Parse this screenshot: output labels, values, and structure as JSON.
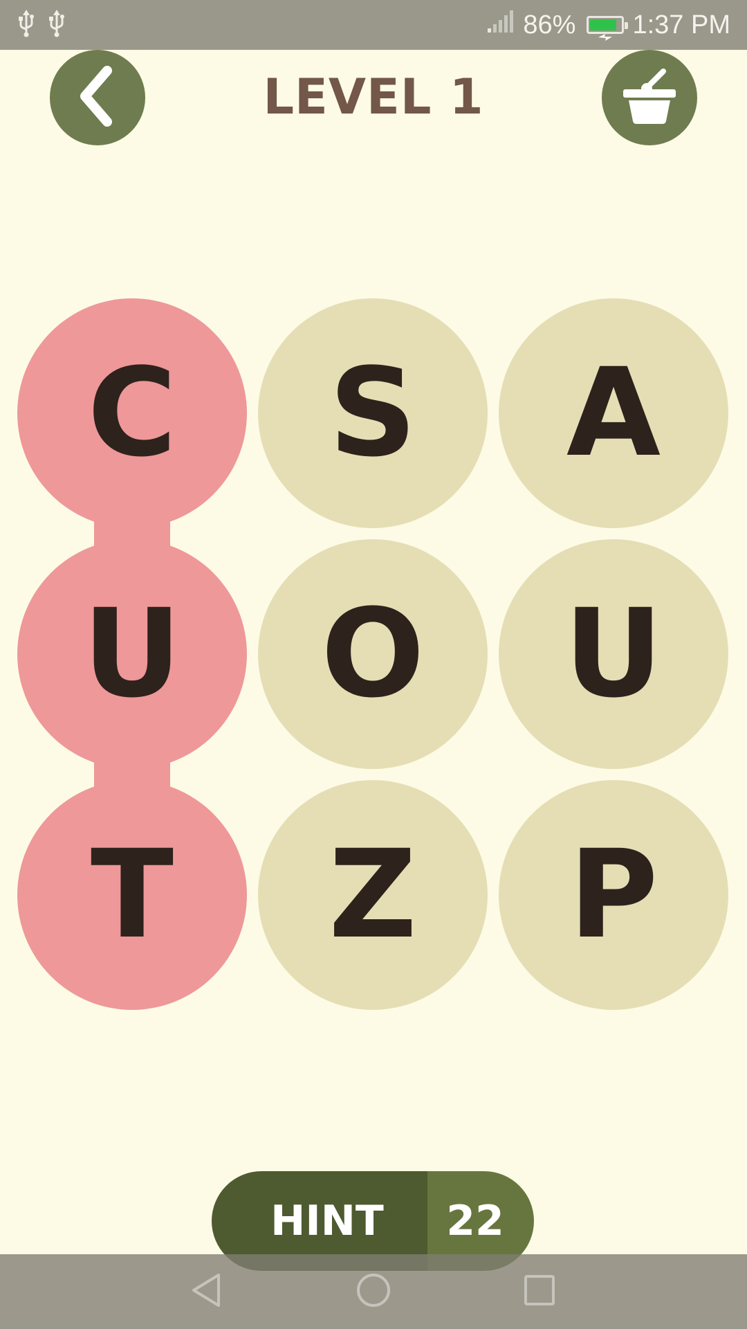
{
  "status_bar": {
    "left_icons": [
      "usb-icon",
      "usb-icon"
    ],
    "battery_percent": "86%",
    "battery_level": 0.86,
    "time": "1:37 PM",
    "battery_fill_color": "#2fc24a"
  },
  "header": {
    "title": "LEVEL 1",
    "back_icon": "chevron-left-icon",
    "shop_icon": "basket-icon"
  },
  "board": {
    "rows": 3,
    "cols": 3,
    "tiles": [
      {
        "letter": "C",
        "selected": true
      },
      {
        "letter": "S",
        "selected": false
      },
      {
        "letter": "A",
        "selected": false
      },
      {
        "letter": "U",
        "selected": true
      },
      {
        "letter": "O",
        "selected": false
      },
      {
        "letter": "U",
        "selected": false
      },
      {
        "letter": "T",
        "selected": true
      },
      {
        "letter": "Z",
        "selected": false
      },
      {
        "letter": "P",
        "selected": false
      }
    ],
    "selected_color": "#ee9899",
    "tile_color": "#e5deb5"
  },
  "hint": {
    "label": "HINT",
    "count": "22"
  },
  "nav_bar": {
    "buttons": [
      "back-triangle-icon",
      "home-circle-icon",
      "recents-square-icon"
    ]
  },
  "colors": {
    "background": "#fdfbe6",
    "accent_green": "#6f7c4f",
    "title_brown": "#735748",
    "letter_dark": "#2e221c"
  }
}
